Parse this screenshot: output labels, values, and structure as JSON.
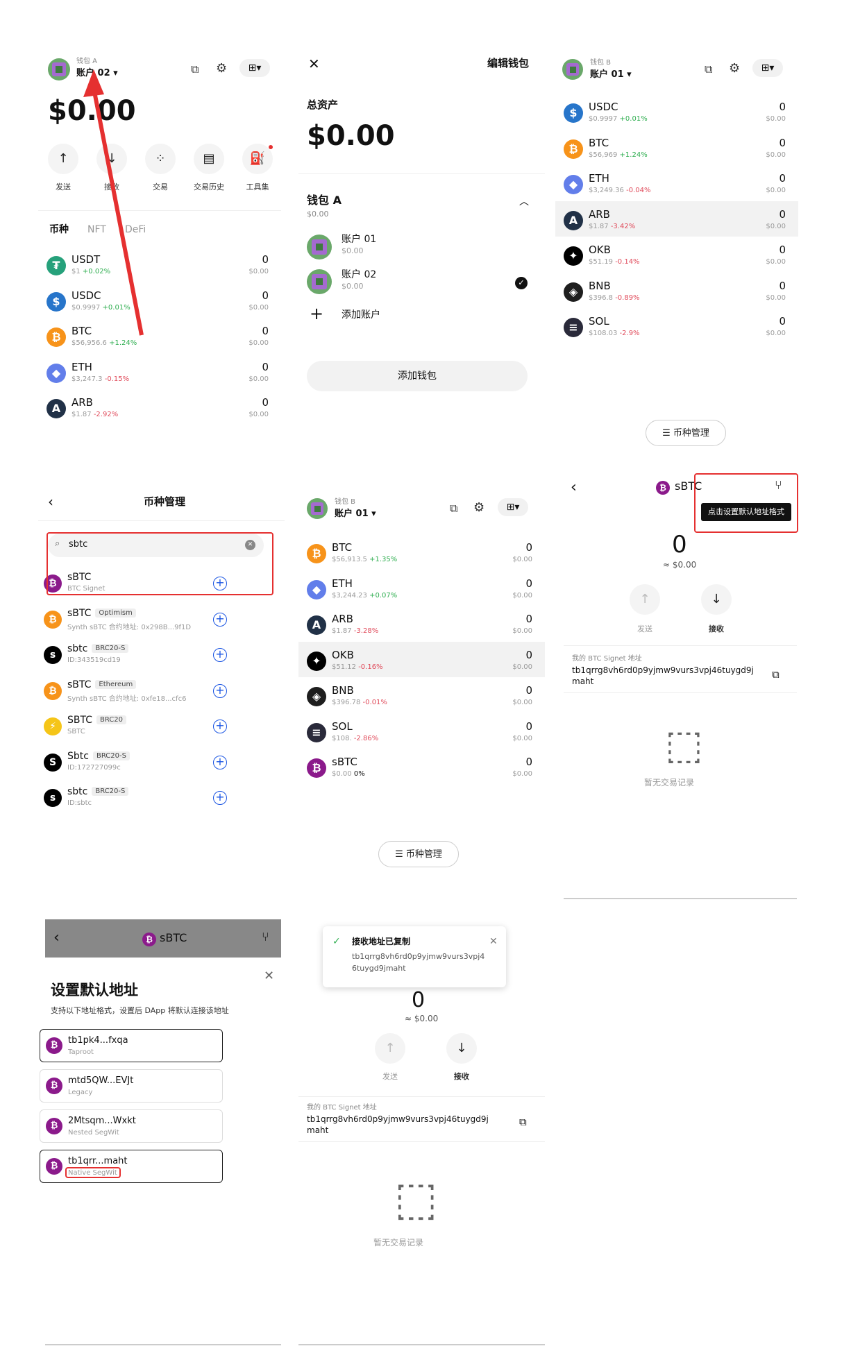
{
  "p1": {
    "wallet": "钱包 A",
    "account": "账户 02 ▾",
    "balance": "$0.00",
    "actions": [
      "发送",
      "接收",
      "交易",
      "交易历史",
      "工具集"
    ],
    "tabs": [
      "币种",
      "NFT",
      "DeFi"
    ],
    "coins": [
      {
        "sym": "USDT",
        "price": "$1",
        "chg": "+0.02%",
        "amt": "0",
        "usd": "$0.00",
        "color": "#26a17b",
        "glyph": "₮",
        "dir": "up"
      },
      {
        "sym": "USDC",
        "price": "$0.9997",
        "chg": "+0.01%",
        "amt": "0",
        "usd": "$0.00",
        "color": "#2775ca",
        "glyph": "$",
        "dir": "up"
      },
      {
        "sym": "BTC",
        "price": "$56,956.6",
        "chg": "+1.24%",
        "amt": "0",
        "usd": "$0.00",
        "color": "#f7931a",
        "glyph": "₿",
        "dir": "up"
      },
      {
        "sym": "ETH",
        "price": "$3,247.3",
        "chg": "-0.15%",
        "amt": "0",
        "usd": "$0.00",
        "color": "#627eea",
        "glyph": "◆",
        "dir": "dn"
      },
      {
        "sym": "ARB",
        "price": "$1.87",
        "chg": "-2.92%",
        "amt": "0",
        "usd": "$0.00",
        "color": "#213147",
        "glyph": "A",
        "dir": "dn"
      }
    ]
  },
  "p2": {
    "edit": "编辑钱包",
    "total_label": "总资产",
    "total": "$0.00",
    "wallet": "钱包 A",
    "wallet_val": "$0.00",
    "accounts": [
      {
        "name": "账户 01",
        "val": "$0.00"
      },
      {
        "name": "账户 02",
        "val": "$0.00"
      }
    ],
    "add_account": "添加账户",
    "add_wallet": "添加钱包"
  },
  "p3": {
    "wallet": "钱包 B",
    "account": "账户 01 ▾",
    "coins": [
      {
        "sym": "USDC",
        "price": "$0.9997",
        "chg": "+0.01%",
        "amt": "0",
        "usd": "$0.00",
        "color": "#2775ca",
        "glyph": "$",
        "dir": "up"
      },
      {
        "sym": "BTC",
        "price": "$56,969",
        "chg": "+1.24%",
        "amt": "0",
        "usd": "$0.00",
        "color": "#f7931a",
        "glyph": "₿",
        "dir": "up"
      },
      {
        "sym": "ETH",
        "price": "$3,249.36",
        "chg": "-0.04%",
        "amt": "0",
        "usd": "$0.00",
        "color": "#627eea",
        "glyph": "◆",
        "dir": "dn"
      },
      {
        "sym": "ARB",
        "price": "$1.87",
        "chg": "-3.42%",
        "amt": "0",
        "usd": "$0.00",
        "color": "#213147",
        "glyph": "A",
        "dir": "dn"
      },
      {
        "sym": "OKB",
        "price": "$51.19",
        "chg": "-0.14%",
        "amt": "0",
        "usd": "$0.00",
        "color": "#000000",
        "glyph": "✦",
        "dir": "dn"
      },
      {
        "sym": "BNB",
        "price": "$396.8",
        "chg": "-0.89%",
        "amt": "0",
        "usd": "$0.00",
        "color": "#1e1e1e",
        "glyph": "◈",
        "dir": "dn"
      },
      {
        "sym": "SOL",
        "price": "$108.03",
        "chg": "-2.9%",
        "amt": "0",
        "usd": "$0.00",
        "color": "#2a2a3a",
        "glyph": "≡",
        "dir": "dn"
      }
    ],
    "manage": "币种管理"
  },
  "p4": {
    "title": "币种管理",
    "search": "sbtc",
    "results": [
      {
        "name": "sBTC",
        "tag": "",
        "sub": "BTC Signet",
        "color": "#8b1a8b",
        "glyph": "₿"
      },
      {
        "name": "sBTC",
        "tag": "Optimism",
        "sub": "Synth sBTC 合约地址: 0x298B...9f1D",
        "color": "#f7931a",
        "glyph": "₿"
      },
      {
        "name": "sbtc",
        "tag": "BRC20-S",
        "sub": "ID:343519cd19",
        "color": "#000000",
        "glyph": "s"
      },
      {
        "name": "sBTC",
        "tag": "Ethereum",
        "sub": "Synth sBTC 合约地址: 0xfe18...cfc6",
        "color": "#f7931a",
        "glyph": "₿"
      },
      {
        "name": "SBTC",
        "tag": "BRC20",
        "sub": "SBTC",
        "color": "#f5c518",
        "glyph": "⚡"
      },
      {
        "name": "Sbtc",
        "tag": "BRC20-S",
        "sub": "ID:172727099c",
        "color": "#000000",
        "glyph": "S"
      },
      {
        "name": "sbtc",
        "tag": "BRC20-S",
        "sub": "ID:sbtc",
        "color": "#000000",
        "glyph": "s"
      }
    ]
  },
  "p5": {
    "wallet": "钱包 B",
    "account": "账户 01 ▾",
    "coins": [
      {
        "sym": "BTC",
        "price": "$56,913.5",
        "chg": "+1.35%",
        "amt": "0",
        "usd": "$0.00",
        "color": "#f7931a",
        "glyph": "₿",
        "dir": "up"
      },
      {
        "sym": "ETH",
        "price": "$3,244.23",
        "chg": "+0.07%",
        "amt": "0",
        "usd": "$0.00",
        "color": "#627eea",
        "glyph": "◆",
        "dir": "up"
      },
      {
        "sym": "ARB",
        "price": "$1.87",
        "chg": "-3.28%",
        "amt": "0",
        "usd": "$0.00",
        "color": "#213147",
        "glyph": "A",
        "dir": "dn"
      },
      {
        "sym": "OKB",
        "price": "$51.12",
        "chg": "-0.16%",
        "amt": "0",
        "usd": "$0.00",
        "color": "#000000",
        "glyph": "✦",
        "dir": "dn"
      },
      {
        "sym": "BNB",
        "price": "$396.78",
        "chg": "-0.01%",
        "amt": "0",
        "usd": "$0.00",
        "color": "#1e1e1e",
        "glyph": "◈",
        "dir": "dn"
      },
      {
        "sym": "SOL",
        "price": "$108.",
        "chg": "-2.86%",
        "amt": "0",
        "usd": "$0.00",
        "color": "#2a2a3a",
        "glyph": "≡",
        "dir": "dn"
      },
      {
        "sym": "sBTC",
        "price": "$0.00",
        "chg": "0%",
        "amt": "0",
        "usd": "$0.00",
        "color": "#8b1a8b",
        "glyph": "₿",
        "dir": "flat"
      }
    ],
    "manage": "币种管理"
  },
  "p6": {
    "coin": "sBTC",
    "tooltip": "点击设置默认地址格式",
    "amount": "0",
    "usd": "≈ $0.00",
    "send": "发送",
    "receive": "接收",
    "addr_label": "我的 BTC Signet 地址",
    "addr1": "tb1qrrg8vh6rd0p9yjmw9vurs3vpj46tuygd9j",
    "addr2": "maht",
    "empty": "暂无交易记录"
  },
  "p7": {
    "coin": "sBTC",
    "title": "设置默认地址",
    "desc": "支持以下地址格式，设置后 DApp 将默认连接该地址",
    "addrs": [
      {
        "addr": "tb1pk4...fxqa",
        "type": "Taproot"
      },
      {
        "addr": "mtd5QW...EVJt",
        "type": "Legacy"
      },
      {
        "addr": "2Mtsqm...Wxkt",
        "type": "Nested SegWit"
      },
      {
        "addr": "tb1qrr...maht",
        "type": "Native SegWit"
      }
    ]
  },
  "p8": {
    "toast_title": "接收地址已复制",
    "toast_addr1": "tb1qrrg8vh6rd0p9yjmw9vurs3vpj4",
    "toast_addr2": "6tuygd9jmaht",
    "amount": "0",
    "usd": "≈ $0.00",
    "send": "发送",
    "receive": "接收",
    "addr_label": "我的 BTC Signet 地址",
    "addr1": "tb1qrrg8vh6rd0p9yjmw9vurs3vpj46tuygd9j",
    "addr2": "maht",
    "empty": "暂无交易记录"
  }
}
